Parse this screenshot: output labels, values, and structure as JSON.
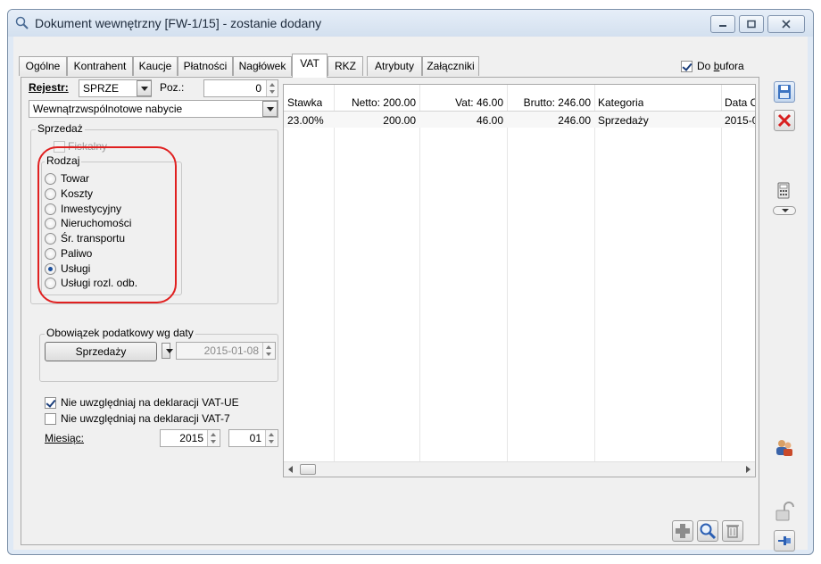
{
  "window": {
    "title": "Dokument wewnętrzny [FW-1/15]  - zostanie dodany"
  },
  "tabs": [
    {
      "label": "Ogólne"
    },
    {
      "label": "Kontrahent"
    },
    {
      "label": "Kaucje"
    },
    {
      "label": "Płatności"
    },
    {
      "label": "Nagłówek"
    },
    {
      "label": "VAT",
      "active": true
    },
    {
      "label": "RKZ"
    },
    {
      "label": "Atrybuty"
    },
    {
      "label": "Załączniki"
    }
  ],
  "do_bufora": {
    "label": "Do bufora",
    "checked": true
  },
  "rejestr": {
    "label": "Rejestr:",
    "value": "SPRZE",
    "poz_label": "Poz.:",
    "poz_value": "0"
  },
  "transaction_type": {
    "value": "Wewnątrzwspólnotowe nabycie"
  },
  "sprzedaz": {
    "title": "Sprzedaż",
    "fiskalny": {
      "label": "Fiskalny",
      "checked": false
    }
  },
  "rodzaj": {
    "title": "Rodzaj",
    "options": [
      {
        "label": "Towar",
        "checked": false
      },
      {
        "label": "Koszty",
        "checked": false
      },
      {
        "label": "Inwestycyjny",
        "checked": false
      },
      {
        "label": "Nieruchomości",
        "checked": false
      },
      {
        "label": "Śr. transportu",
        "checked": false
      },
      {
        "label": "Paliwo",
        "checked": false
      },
      {
        "label": "Usługi",
        "checked": true
      },
      {
        "label": "Usługi rozl. odb.",
        "checked": false
      }
    ]
  },
  "obowiazek": {
    "title": "Obowiązek podatkowy wg daty",
    "button_label": "Sprzedaży",
    "date": "2015-01-08"
  },
  "checkboxes": [
    {
      "label": "Nie uwzględniaj na deklaracji VAT-UE",
      "checked": true
    },
    {
      "label": "Nie uwzględniaj na deklaracji VAT-7",
      "checked": false
    }
  ],
  "miesiac": {
    "label": "Miesiąc:",
    "year": "2015",
    "month": "01"
  },
  "grid": {
    "columns": [
      "Stawka",
      "Netto: 200.00",
      "Vat: 46.00",
      "Brutto: 246.00",
      "Kategoria",
      "Data O"
    ],
    "rows": [
      [
        "23.00%",
        "200.00",
        "46.00",
        "246.00",
        "Sprzedaży",
        "2015-0"
      ]
    ]
  },
  "icons": {
    "title": "magnifier-icon",
    "save": "save-icon",
    "cancel": "cancel-icon",
    "calculator": "calculator-icon",
    "users": "users-icon",
    "lock": "unlock-icon",
    "pin": "pin-icon",
    "add": "add-icon",
    "preview": "preview-icon",
    "delete": "trash-icon"
  },
  "colors": {
    "highlight_circle": "#e02020",
    "accent_blue": "#2b5fb3"
  }
}
